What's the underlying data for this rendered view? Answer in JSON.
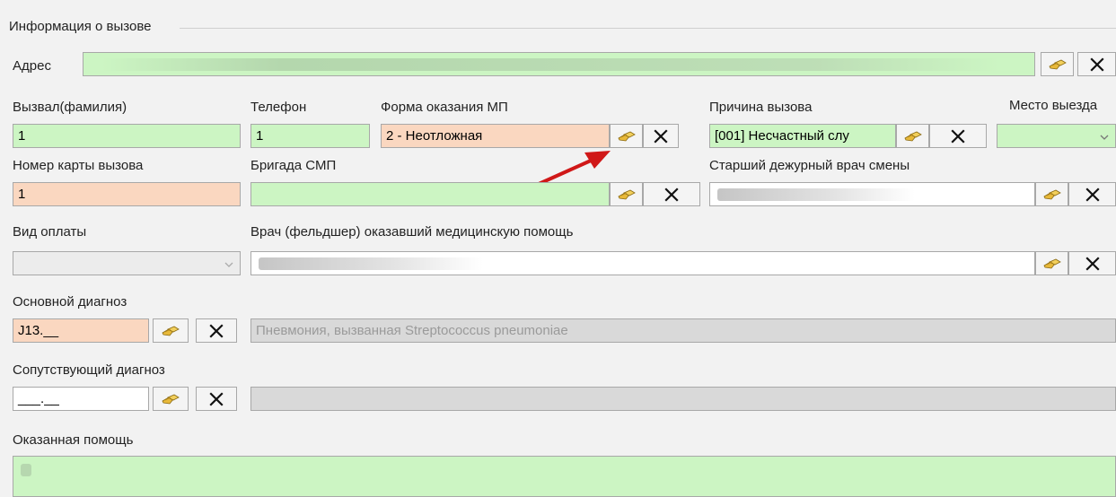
{
  "group": {
    "title": "Информация о вызове"
  },
  "address": {
    "label": "Адрес",
    "value": ""
  },
  "caller": {
    "label": "Вызвал(фамилия)",
    "value": "1"
  },
  "phone": {
    "label": "Телефон",
    "value": "1"
  },
  "care_form": {
    "label": "Форма оказания МП",
    "value": "2 - Неотложная"
  },
  "call_reason": {
    "label": "Причина вызова",
    "value": "[001] Несчастный слу"
  },
  "departure_place": {
    "label": "Место выезда",
    "value": ""
  },
  "card_number": {
    "label": "Номер карты вызова",
    "value": "1"
  },
  "ems_team": {
    "label": "Бригада СМП",
    "value": ""
  },
  "senior_doctor": {
    "label": "Старший дежурный врач смены",
    "value": ""
  },
  "payment_type": {
    "label": "Вид оплаты",
    "value": ""
  },
  "attending_doctor": {
    "label": "Врач (фельдшер) оказавший медицинскую помощь",
    "value": ""
  },
  "main_diagnosis": {
    "label": "Основной диагноз",
    "code": "J13.__",
    "description": "Пневмония, вызванная Streptococcus pneumoniae"
  },
  "concomitant_diagnosis": {
    "label": "Сопутствующий диагноз",
    "code": "___.__",
    "description": ""
  },
  "care_provided": {
    "label": "Оказанная помощь",
    "value": ""
  },
  "colors": {
    "required_green": "#ccf5c3",
    "required_peach": "#fad7c0",
    "annotation_arrow": "#d01818"
  },
  "icons": {
    "lookup": "lookup-icon",
    "clear": "close-icon",
    "dropdown": "chevron-down-icon"
  }
}
